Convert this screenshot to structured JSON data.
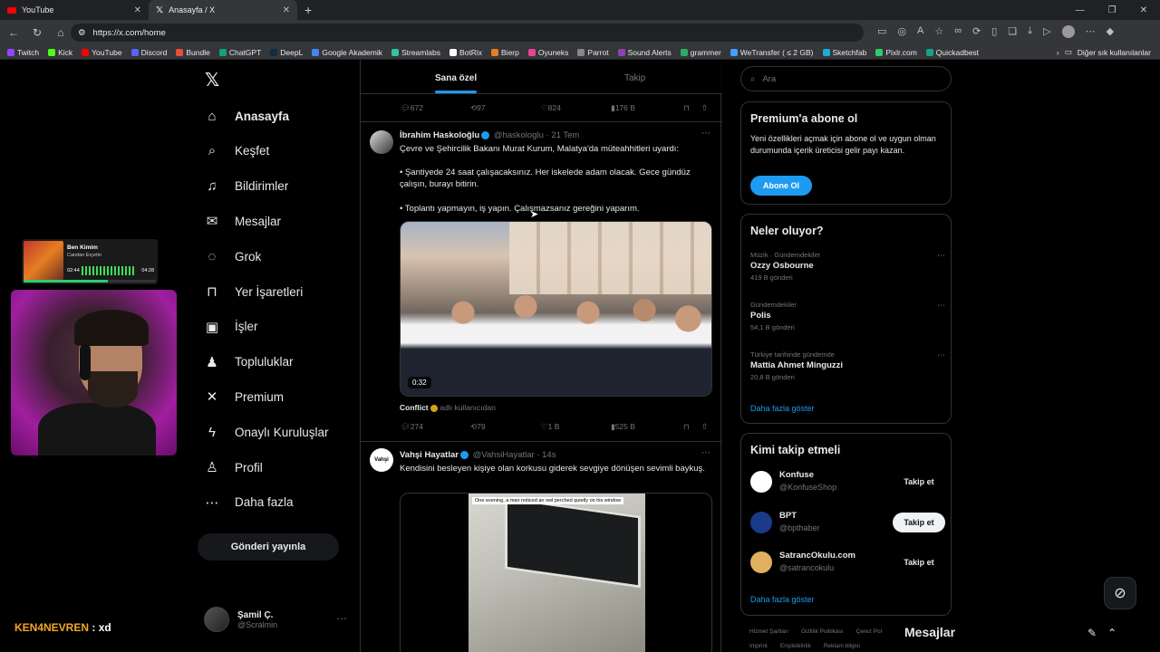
{
  "browser": {
    "tabs": [
      {
        "title": "YouTube",
        "icon": "youtube-icon"
      },
      {
        "title": "Anasayfa / X",
        "icon": "x-logo-icon"
      }
    ],
    "url": "https://x.com/home",
    "bookmarks": [
      {
        "label": "Twitch",
        "color": "#9146ff"
      },
      {
        "label": "Kick",
        "color": "#53fc18"
      },
      {
        "label": "YouTube",
        "color": "#ff0000"
      },
      {
        "label": "Discord",
        "color": "#5865f2"
      },
      {
        "label": "Bundle",
        "color": "#e74c3c"
      },
      {
        "label": "ChatGPT",
        "color": "#10a37f"
      },
      {
        "label": "DeepL",
        "color": "#0f2b46"
      },
      {
        "label": "Google Akademik",
        "color": "#4285f4"
      },
      {
        "label": "Streamlabs",
        "color": "#31c3a2"
      },
      {
        "label": "BotRix",
        "color": "#ffffff"
      },
      {
        "label": "Bierp",
        "color": "#e67e22"
      },
      {
        "label": "Oyuneks",
        "color": "#e84393"
      },
      {
        "label": "Parrot",
        "color": "#888888"
      },
      {
        "label": "Sound Alerts",
        "color": "#8e44ad"
      },
      {
        "label": "grammer",
        "color": "#27ae60"
      },
      {
        "label": "WeTransfer ( ≤ 2 GB)",
        "color": "#409fff"
      },
      {
        "label": "Sketchfab",
        "color": "#1caad9"
      },
      {
        "label": "Pixlr.com",
        "color": "#2ecc71"
      },
      {
        "label": "Quickadbest",
        "color": "#16a085"
      }
    ],
    "other_bookmarks": "Diğer sık kullanılanlar"
  },
  "overlay": {
    "song": "Ben Kimim",
    "artist": "Candan Erçetin",
    "time_elapsed": "02:44",
    "time_total": "04:28",
    "song_progress": 0.64,
    "chat_user": "KEN4NEVREN",
    "chat_sep": ":",
    "chat_message": "xd"
  },
  "nav": {
    "items": [
      {
        "label": "Anasayfa",
        "icon": "home-icon",
        "glyph": "⌂",
        "active": true
      },
      {
        "label": "Keşfet",
        "icon": "search-icon",
        "glyph": "⌕"
      },
      {
        "label": "Bildirimler",
        "icon": "bell-icon",
        "glyph": "♫"
      },
      {
        "label": "Mesajlar",
        "icon": "mail-icon",
        "glyph": "✉"
      },
      {
        "label": "Grok",
        "icon": "grok-icon",
        "glyph": "◌"
      },
      {
        "label": "Yer İşaretleri",
        "icon": "bookmark-icon",
        "glyph": "⊓"
      },
      {
        "label": "İşler",
        "icon": "briefcase-icon",
        "glyph": "▣"
      },
      {
        "label": "Topluluklar",
        "icon": "communities-icon",
        "glyph": "♟"
      },
      {
        "label": "Premium",
        "icon": "x-premium-icon",
        "glyph": "✕"
      },
      {
        "label": "Onaylı Kuruluşlar",
        "icon": "lightning-icon",
        "glyph": "ϟ"
      },
      {
        "label": "Profil",
        "icon": "profile-icon",
        "glyph": "♙"
      },
      {
        "label": "Daha fazla",
        "icon": "more-circle-icon",
        "glyph": "⋯"
      }
    ],
    "post_button": "Gönderi yayınla",
    "account_name": "Şamil Ç.",
    "account_handle": "@Scralmin"
  },
  "timeline": {
    "tab_for_you": "Sana özel",
    "tab_following": "Takip",
    "prev_actions": {
      "replies": "672",
      "reposts": "97",
      "likes": "824",
      "views": "176 B"
    },
    "tweet1": {
      "name": "İbrahim Haskoloğlu",
      "handle": "@haskologlu",
      "time": "21 Tem",
      "text1": "Çevre ve Şehircilik Bakanı Murat Kurum, Malatya'da müteahhitleri uyardı:",
      "text2": "• Şantiyede 24 saat çalışacaksınız. Her iskelede adam olacak. Gece gündüz çalışın, burayı bitirin.",
      "text3": "• Toplantı yapmayın, iş yapın. Çalışmazsanız gereğini yaparım.",
      "video_duration": "0:32",
      "source_name": "Conflict",
      "source_suffix": "adlı kullanıcıdan",
      "replies": "274",
      "reposts": "79",
      "likes": "1 B",
      "views": "525 B"
    },
    "tweet2": {
      "name": "Vahşi Hayatlar",
      "handle": "@VahsiHayatlar",
      "time": "14s",
      "avatar_text": "Vahşi",
      "text": "Kendisini besleyen kişiye olan korkusu giderek sevgiye dönüşen sevimli baykuş.",
      "image_caption": "One evening, a man noticed an owl perched quietly on his window"
    }
  },
  "right": {
    "search_placeholder": "Ara",
    "premium_title": "Premium'a abone ol",
    "premium_desc": "Yeni özellikleri açmak için abone ol ve uygun olman durumunda içerik üreticisi gelir payı kazan.",
    "premium_button": "Abone Ol",
    "trends_title": "Neler oluyor?",
    "trends": [
      {
        "context": "Müzik · Gündemdekiler",
        "topic": "Ozzy Osbourne",
        "count": "419 B gönderi"
      },
      {
        "context": "Gündemdekiler",
        "topic": "Polis",
        "count": "54,1 B gönderi"
      },
      {
        "context": "Türkiye tarihinde gündemde",
        "topic": "Mattia Ahmet Minguzzi",
        "count": "20,8 B gönderi"
      }
    ],
    "trends_more": "Daha fazla göster",
    "who_title": "Kimi takip etmeli",
    "who": [
      {
        "name": "Konfuse",
        "handle": "@KonfuseShop",
        "button": "Takip et"
      },
      {
        "name": "BPT",
        "handle": "@bpthaber",
        "button": "Takip et"
      },
      {
        "name": "SatrancOkulu.com",
        "handle": "@satrancokulu",
        "button": "Takip et"
      }
    ],
    "who_more": "Daha fazla göster",
    "footer1": [
      "Hizmet Şartları",
      "Gizlilik Politikası",
      "Çerez Pol"
    ],
    "footer2": [
      "Imprint",
      "Erişilebilirlik",
      "Reklam bilgisi"
    ],
    "messages_drawer": "Mesajlar"
  }
}
